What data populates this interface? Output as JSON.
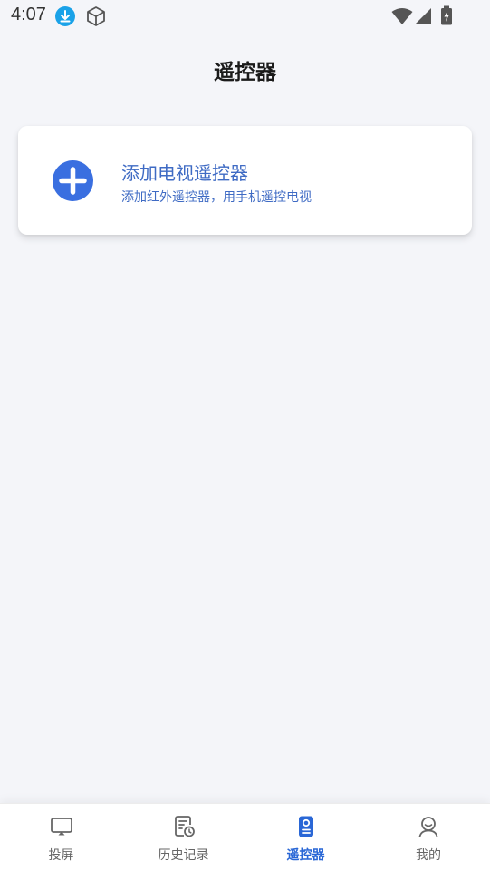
{
  "status_bar": {
    "time": "4:07",
    "icons": [
      "download-icon",
      "package-icon",
      "wifi-icon",
      "signal-icon",
      "battery-icon"
    ]
  },
  "header": {
    "title": "遥控器"
  },
  "add_card": {
    "title": "添加电视遥控器",
    "subtitle": "添加红外遥控器，用手机遥控电视",
    "icon": "plus-circle-icon"
  },
  "tab_bar": {
    "tabs": [
      {
        "label": "投屏",
        "icon": "cast-screen-icon",
        "active": false
      },
      {
        "label": "历史记录",
        "icon": "history-icon",
        "active": false
      },
      {
        "label": "遥控器",
        "icon": "remote-control-icon",
        "active": true
      },
      {
        "label": "我的",
        "icon": "profile-icon",
        "active": false
      }
    ]
  },
  "colors": {
    "accent": "#2a67d6",
    "card_text": "#3f6bc4",
    "plus_icon": "#3a6fe0",
    "background": "#f4f5f9"
  }
}
